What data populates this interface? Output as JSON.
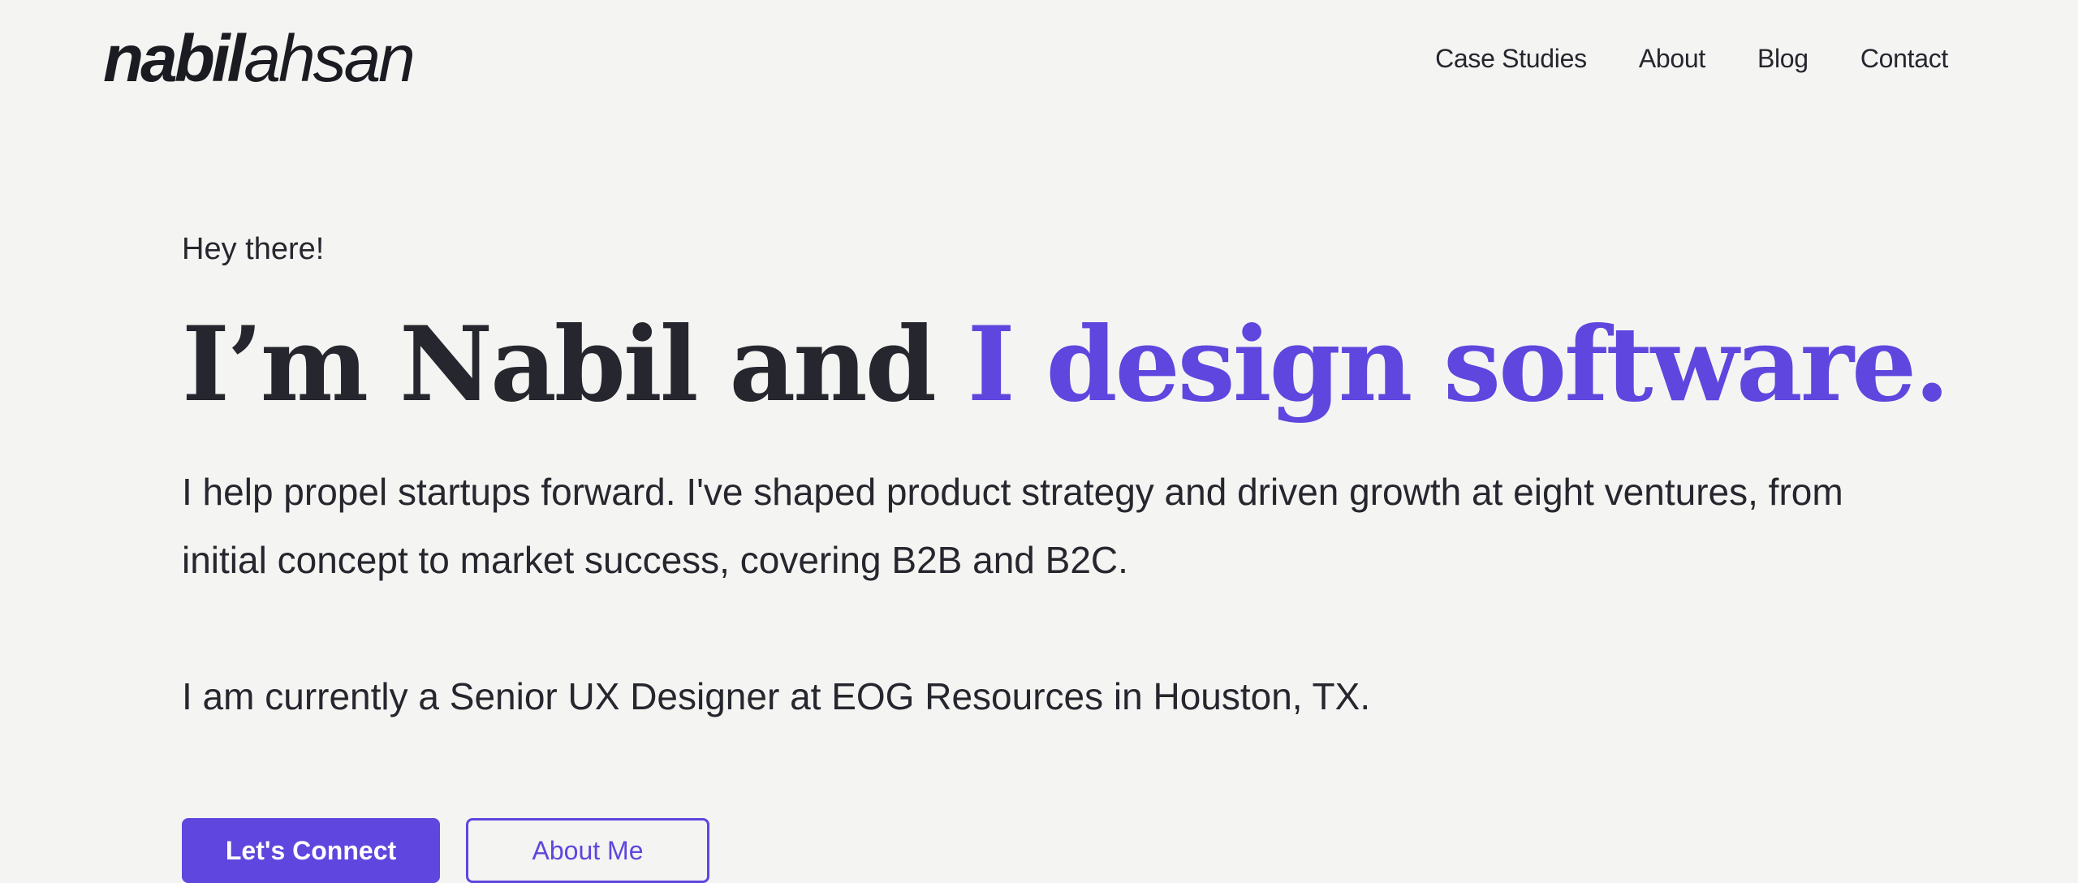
{
  "header": {
    "logo": {
      "first": "nabil",
      "last": "ahsan"
    },
    "nav": [
      {
        "label": "Case Studies"
      },
      {
        "label": "About"
      },
      {
        "label": "Blog"
      },
      {
        "label": "Contact"
      }
    ]
  },
  "hero": {
    "greeting": "Hey there!",
    "headline_main": "I’m Nabil and ",
    "headline_accent": "I design software.",
    "intro": "I help propel startups forward. I've shaped product strategy and driven growth at eight ventures, from initial concept to market success, covering B2B and B2C.",
    "role": "I am currently a Senior UX Designer at EOG Resources in Houston, TX.",
    "primary_button": "Let's Connect",
    "secondary_button": "About Me"
  },
  "colors": {
    "accent": "#5f46de",
    "background": "#f4f4f2",
    "text": "#26262e"
  }
}
